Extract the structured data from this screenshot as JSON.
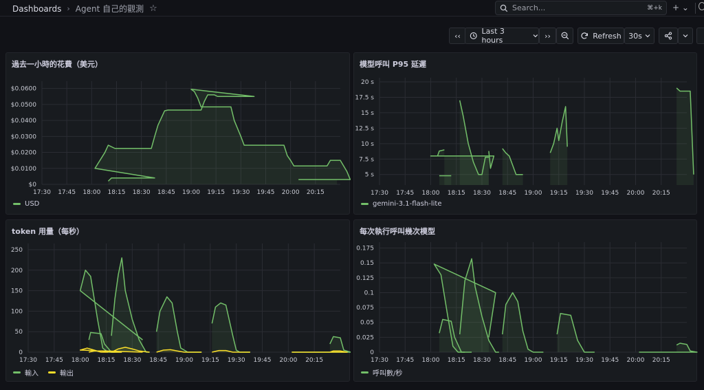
{
  "breadcrumb": {
    "root": "Dashboards",
    "sep": "›",
    "current": "Agent 自己的觀測"
  },
  "search": {
    "placeholder": "Search...",
    "shortcut": "⌘+k"
  },
  "header": {
    "add_label": "+ ⌄"
  },
  "toolbar": {
    "back_label": "‹‹",
    "time_range": "Last 3 hours",
    "forward_label": "››",
    "refresh_label": "Refresh",
    "refresh_interval": "30s"
  },
  "colors": {
    "green": "#73bf69",
    "yellow": "#fade2a"
  },
  "chart_data": [
    {
      "id": "cost",
      "type": "line",
      "title": "過去一小時的花費（美元）",
      "x_ticks": [
        "17:30",
        "17:45",
        "18:00",
        "18:15",
        "18:30",
        "18:45",
        "19:00",
        "19:15",
        "19:30",
        "19:45",
        "20:00",
        "20:15"
      ],
      "y_ticks": [
        "$0",
        "$0.0100",
        "$0.0200",
        "$0.0300",
        "$0.0400",
        "$0.0500",
        "$0.0600"
      ],
      "ylim": [
        0,
        0.062
      ],
      "xlim": [
        17.3,
        20.3
      ],
      "series": [
        {
          "name": "USD",
          "color": "#73bf69",
          "points": [
            [
              17.7,
              0.002
            ],
            [
              17.72,
              0.004
            ],
            [
              17.76,
              0.004
            ],
            [
              17.84,
              0.004
            ],
            [
              17.92,
              0.004
            ],
            [
              17.98,
              0.004
            ],
            [
              18.02,
              0.01
            ],
            [
              18.08,
              0.02
            ],
            [
              18.1,
              0.0245
            ],
            [
              18.14,
              0.0225
            ],
            [
              18.2,
              0.0225
            ],
            [
              18.3,
              0.0225
            ],
            [
              18.36,
              0.0225
            ],
            [
              18.38,
              0.03
            ],
            [
              18.4,
              0.037
            ],
            [
              18.44,
              0.046
            ],
            [
              18.46,
              0.0465
            ],
            [
              18.5,
              0.0465
            ],
            [
              18.6,
              0.0465
            ],
            [
              18.66,
              0.0465
            ],
            [
              18.68,
              0.052
            ],
            [
              18.7,
              0.056
            ],
            [
              18.74,
              0.056
            ],
            [
              18.76,
              0.055
            ],
            [
              18.82,
              0.055
            ],
            [
              18.92,
              0.055
            ],
            [
              18.98,
              0.055
            ],
            [
              19.0,
              0.0595
            ],
            [
              19.02,
              0.058
            ],
            [
              19.04,
              0.054
            ],
            [
              19.06,
              0.0485
            ],
            [
              19.1,
              0.0485
            ],
            [
              19.2,
              0.0485
            ],
            [
              19.24,
              0.0485
            ],
            [
              19.26,
              0.04
            ],
            [
              19.3,
              0.03
            ],
            [
              19.32,
              0.0245
            ],
            [
              19.4,
              0.0245
            ],
            [
              19.5,
              0.0245
            ],
            [
              19.56,
              0.0245
            ],
            [
              19.58,
              0.018
            ],
            [
              19.6,
              0.015
            ],
            [
              19.62,
              0.0115
            ],
            [
              19.7,
              0.0115
            ],
            [
              19.82,
              0.0115
            ],
            [
              19.84,
              0.015
            ],
            [
              19.9,
              0.015
            ],
            [
              19.92,
              0.0115
            ],
            [
              19.94,
              0.008
            ],
            [
              19.96,
              0.003
            ],
            [
              20.05,
              0.003
            ],
            [
              20.28,
              0.003
            ]
          ]
        }
      ]
    },
    {
      "id": "latency",
      "type": "line",
      "title": "模型呼叫 P95 延遲",
      "x_ticks": [
        "17:30",
        "17:45",
        "18:00",
        "18:15",
        "18:30",
        "18:45",
        "19:00",
        "19:15",
        "19:30",
        "19:45",
        "20:00",
        "20:15"
      ],
      "y_ticks": [
        "5 s",
        "7.5 s",
        "10 s",
        "12.5 s",
        "15 s",
        "17.5 s",
        "20 s"
      ],
      "ylim": [
        3.3,
        20
      ],
      "xlim": [
        17.3,
        20.3
      ],
      "series": [
        {
          "name": "gemini-3.1-flash-lite",
          "color": "#73bf69",
          "segments": [
            [
              [
                17.65,
                4.8
              ],
              [
                17.72,
                4.8
              ]
            ],
            [
              [
                17.94,
                8.8
              ],
              [
                17.95,
                6.0
              ],
              [
                17.97,
                8.0
              ],
              [
                18.0,
                8.0
              ],
              [
                18.04,
                8.0
              ],
              [
                18.05,
                8.8
              ],
              [
                18.08,
                9.0
              ]
            ],
            [
              [
                18.17,
                17.0
              ],
              [
                18.19,
                14.5
              ],
              [
                18.22,
                10.0
              ],
              [
                18.25,
                7.0
              ],
              [
                18.28,
                5.0
              ],
              [
                18.3,
                5.0
              ],
              [
                18.32,
                7.8
              ],
              [
                18.34,
                7.8
              ]
            ],
            [
              [
                18.42,
                9.2
              ],
              [
                18.44,
                8.5
              ],
              [
                18.46,
                8.0
              ],
              [
                18.48,
                6.5
              ],
              [
                18.5,
                5.0
              ],
              [
                18.54,
                5.0
              ]
            ],
            [
              [
                18.7,
                8.5
              ],
              [
                18.72,
                10.0
              ],
              [
                18.74,
                12.5
              ],
              [
                18.75,
                10.5
              ],
              [
                18.77,
                13.5
              ],
              [
                18.79,
                16.0
              ],
              [
                18.8,
                9.5
              ]
            ],
            [
              [
                19.84,
                19.0
              ],
              [
                19.86,
                18.5
              ],
              [
                19.92,
                18.5
              ],
              [
                19.94,
                5.0
              ]
            ]
          ]
        }
      ]
    },
    {
      "id": "tokens",
      "type": "line",
      "title": "token 用量（每秒）",
      "x_ticks": [
        "17:30",
        "17:45",
        "18:00",
        "18:15",
        "18:30",
        "18:45",
        "19:00",
        "19:15",
        "19:30",
        "19:45",
        "20:00",
        "20:15"
      ],
      "y_ticks": [
        "0",
        "50",
        "100",
        "150",
        "200",
        "250"
      ],
      "ylim": [
        0,
        255
      ],
      "xlim": [
        17.3,
        20.3
      ],
      "series": [
        {
          "name": "輸入",
          "color": "#73bf69",
          "segments": [
            [
              [
                17.65,
                30
              ],
              [
                17.66,
                48
              ],
              [
                17.72,
                45
              ],
              [
                17.74,
                20
              ],
              [
                17.78,
                0
              ],
              [
                17.84,
                0
              ]
            ],
            [
              [
                17.96,
                30
              ],
              [
                18.0,
                150
              ],
              [
                18.03,
                200
              ],
              [
                18.06,
                185
              ],
              [
                18.1,
                80
              ],
              [
                18.13,
                10
              ],
              [
                18.16,
                0
              ],
              [
                18.2,
                0
              ]
            ],
            [
              [
                18.18,
                40
              ],
              [
                18.2,
                130
              ],
              [
                18.22,
                190
              ],
              [
                18.24,
                230
              ],
              [
                18.26,
                150
              ],
              [
                18.3,
                80
              ],
              [
                18.34,
                30
              ],
              [
                18.38,
                0
              ],
              [
                18.4,
                0
              ]
            ],
            [
              [
                18.44,
                50
              ],
              [
                18.46,
                100
              ],
              [
                18.5,
                135
              ],
              [
                18.53,
                120
              ],
              [
                18.56,
                50
              ],
              [
                18.58,
                10
              ],
              [
                18.62,
                0
              ],
              [
                18.7,
                0
              ]
            ],
            [
              [
                18.76,
                70
              ],
              [
                18.78,
                110
              ],
              [
                18.81,
                120
              ],
              [
                18.84,
                115
              ],
              [
                18.88,
                40
              ],
              [
                18.9,
                5
              ],
              [
                18.92,
                0
              ],
              [
                18.98,
                0
              ]
            ],
            [
              [
                19.84,
                20
              ],
              [
                19.86,
                38
              ],
              [
                19.9,
                35
              ],
              [
                19.92,
                5
              ],
              [
                19.96,
                0
              ],
              [
                20.02,
                0
              ]
            ]
          ]
        },
        {
          "name": "輸出",
          "color": "#fade2a",
          "segments": [
            [
              [
                17.65,
                0
              ],
              [
                17.68,
                3
              ],
              [
                17.72,
                3
              ],
              [
                17.78,
                0
              ],
              [
                17.84,
                0
              ]
            ],
            [
              [
                17.96,
                0
              ],
              [
                18.0,
                5
              ],
              [
                18.04,
                10
              ],
              [
                18.08,
                5
              ],
              [
                18.12,
                0
              ],
              [
                18.16,
                0
              ]
            ],
            [
              [
                18.18,
                0
              ],
              [
                18.22,
                8
              ],
              [
                18.26,
                12
              ],
              [
                18.3,
                8
              ],
              [
                18.34,
                3
              ],
              [
                18.4,
                0
              ]
            ],
            [
              [
                18.44,
                0
              ],
              [
                18.48,
                5
              ],
              [
                18.52,
                6
              ],
              [
                18.56,
                3
              ],
              [
                18.6,
                0
              ],
              [
                18.7,
                0
              ]
            ],
            [
              [
                18.76,
                0
              ],
              [
                18.8,
                4
              ],
              [
                18.84,
                4
              ],
              [
                18.88,
                0
              ],
              [
                18.98,
                0
              ]
            ],
            [
              [
                19.84,
                0
              ],
              [
                19.86,
                3
              ],
              [
                19.9,
                3
              ],
              [
                19.94,
                0
              ],
              [
                20.02,
                0
              ]
            ]
          ]
        }
      ]
    },
    {
      "id": "calls",
      "type": "line",
      "title": "每次執行呼叫幾次模型",
      "x_ticks": [
        "17:30",
        "17:45",
        "18:00",
        "18:15",
        "18:30",
        "18:45",
        "19:00",
        "19:15",
        "19:30",
        "19:45",
        "20:00",
        "20:15"
      ],
      "y_ticks": [
        "0",
        "0.025",
        "0.05",
        "0.075",
        "0.1",
        "0.125",
        "0.15",
        "0.175"
      ],
      "ylim": [
        0,
        0.178
      ],
      "xlim": [
        17.3,
        20.3
      ],
      "series": [
        {
          "name": "呼叫數/秒",
          "color": "#73bf69",
          "segments": [
            [
              [
                17.65,
                0.032
              ],
              [
                17.67,
                0.055
              ],
              [
                17.72,
                0.052
              ],
              [
                17.74,
                0.025
              ],
              [
                17.78,
                0
              ],
              [
                17.84,
                0
              ]
            ],
            [
              [
                17.94,
                0.025
              ],
              [
                17.98,
                0.1
              ],
              [
                18.02,
                0.148
              ],
              [
                18.06,
                0.13
              ],
              [
                18.1,
                0.06
              ],
              [
                18.13,
                0.01
              ],
              [
                18.16,
                0
              ],
              [
                18.2,
                0
              ]
            ],
            [
              [
                18.17,
                0.03
              ],
              [
                18.2,
                0.12
              ],
              [
                18.24,
                0.157
              ],
              [
                18.26,
                0.11
              ],
              [
                18.3,
                0.06
              ],
              [
                18.34,
                0.02
              ],
              [
                18.38,
                0
              ],
              [
                18.4,
                0
              ]
            ],
            [
              [
                18.42,
                0.03
              ],
              [
                18.44,
                0.08
              ],
              [
                18.48,
                0.1
              ],
              [
                18.51,
                0.085
              ],
              [
                18.54,
                0.035
              ],
              [
                18.57,
                0.005
              ],
              [
                18.6,
                0
              ],
              [
                18.66,
                0
              ]
            ],
            [
              [
                18.74,
                0.03
              ],
              [
                18.76,
                0.065
              ],
              [
                18.82,
                0.062
              ],
              [
                18.86,
                0.02
              ],
              [
                18.9,
                0
              ],
              [
                18.96,
                0
              ]
            ],
            [
              [
                19.84,
                0.012
              ],
              [
                19.86,
                0.015
              ],
              [
                19.9,
                0.013
              ],
              [
                19.92,
                0.002
              ],
              [
                19.96,
                0
              ],
              [
                20.02,
                0
              ]
            ]
          ]
        }
      ]
    }
  ]
}
